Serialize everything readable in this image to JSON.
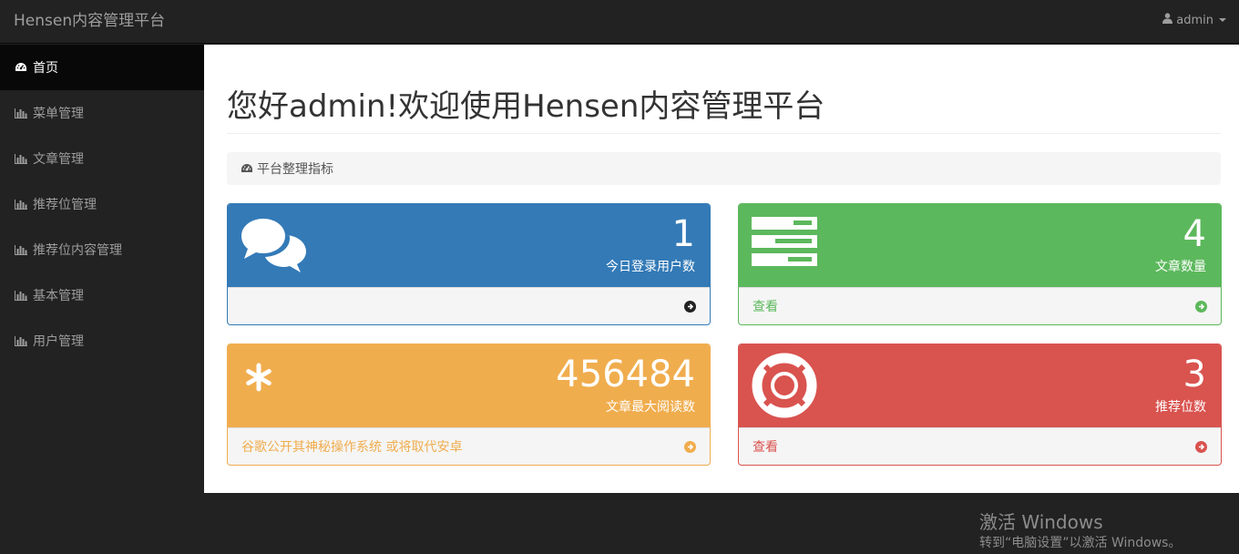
{
  "navbar": {
    "brand": "Hensen内容管理平台",
    "user": "admin",
    "user_icon": "user-icon"
  },
  "sidebar": {
    "items": [
      {
        "label": "首页",
        "icon": "dashboard-icon",
        "active": true
      },
      {
        "label": "菜单管理",
        "icon": "bar-chart-icon"
      },
      {
        "label": "文章管理",
        "icon": "bar-chart-icon"
      },
      {
        "label": "推荐位管理",
        "icon": "bar-chart-icon"
      },
      {
        "label": "推荐位内容管理",
        "icon": "bar-chart-icon"
      },
      {
        "label": "基本管理",
        "icon": "bar-chart-icon"
      },
      {
        "label": "用户管理",
        "icon": "bar-chart-icon"
      }
    ]
  },
  "main": {
    "title": "您好admin!欢迎使用Hensen内容管理平台",
    "breadcrumb": "平台整理指标"
  },
  "panels": [
    {
      "value": "1",
      "label": "今日登录用户数",
      "footer": "",
      "icon": "comments-icon",
      "color": "#337ab7"
    },
    {
      "value": "4",
      "label": "文章数量",
      "footer": "查看",
      "icon": "tasks-icon",
      "color": "#5cb85c"
    },
    {
      "value": "456484",
      "label": "文章最大阅读数",
      "footer": "谷歌公开其神秘操作系统 或将取代安卓",
      "icon": "asterisk-icon",
      "color": "#f0ad4e"
    },
    {
      "value": "3",
      "label": "推荐位数",
      "footer": "查看",
      "icon": "life-ring-icon",
      "color": "#d9534f"
    }
  ],
  "watermark": {
    "title": "激活 Windows",
    "subtitle": "转到“电脑设置”以激活 Windows。"
  }
}
